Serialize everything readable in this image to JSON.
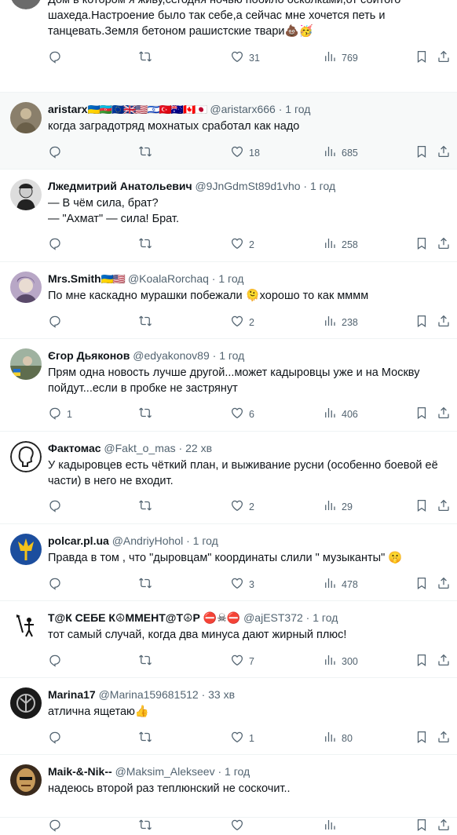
{
  "colors": {
    "text": "#0f1419",
    "muted": "#536471",
    "divider": "#eff3f4",
    "highlight": "#f7f9f9"
  },
  "tweets": [
    {
      "name": "",
      "handle": "",
      "time": "",
      "body": "Дом в котором я живу,сегодня ночью побило осколками,от сбитого шахеда.Настроение было так себе,а сейчас мне хочется петь и танцевать.Земля бетоном рашистские твари💩🥳",
      "replies": "",
      "retweets": "",
      "likes": "31",
      "views": "769"
    },
    {
      "name": "aristarx",
      "flags": "🇺🇦🇦🇿🇪🇺🇬🇧🇺🇸🇮🇱🇹🇷🇦🇺🇨🇦🇯🇵",
      "handle": "@aristarx666",
      "time": "1 год",
      "body": "когда заградотряд мохнатых сработал как надо",
      "replies": "",
      "retweets": "",
      "likes": "18",
      "views": "685"
    },
    {
      "name": "Лжедмитрий Анатольевич",
      "handle": "@9JnGdmSt89d1vho",
      "time": "1 год",
      "body": "— В чём сила, брат?\n— \"Ахмат\" — сила! Брат.",
      "replies": "",
      "retweets": "",
      "likes": "2",
      "views": "258"
    },
    {
      "name": "Mrs.Smith",
      "flags": "🇺🇦🇺🇸",
      "handle": "@KoalaRorchaq",
      "time": "1 год",
      "body": "По мне каскадно мурашки побежали 🫠хорошо то как мммм",
      "replies": "",
      "retweets": "",
      "likes": "2",
      "views": "238"
    },
    {
      "name": "Єгор Дьяконов",
      "handle": "@edyakonov89",
      "time": "1 год",
      "body": "Прям одна новость лучше другой...может кадыровцы уже и на Москву пойдут...если в пробке не застрянут",
      "replies": "1",
      "retweets": "",
      "likes": "6",
      "views": "406"
    },
    {
      "name": "Фактомас",
      "handle": "@Fakt_o_mas",
      "time": "22 хв",
      "body": "У кадыровцев есть чёткий план, и выживание русни (особенно боевой её части) в него не входит.",
      "replies": "",
      "retweets": "",
      "likes": "2",
      "views": "29"
    },
    {
      "name": "polcar.pl.ua",
      "handle": "@AndriyHohol",
      "time": "1 год",
      "body": "Правда в том , что \"дыровцам\"  координаты слили \" музыканты\" 🤫",
      "replies": "",
      "retweets": "",
      "likes": "3",
      "views": "478"
    },
    {
      "name": "Т@К СЕБЕ К☮ММЕНТ@Т☮Р ⛔☠⛔",
      "handle": "@ajEST372",
      "time": "1 год",
      "body": "тот самый случай, когда два минуса дают жирный плюс!",
      "replies": "",
      "retweets": "",
      "likes": "7",
      "views": "300"
    },
    {
      "name": "Marina17",
      "handle": "@Marina159681512",
      "time": "33 хв",
      "body": "атлична ящетаю👍",
      "replies": "",
      "retweets": "",
      "likes": "1",
      "views": "80"
    },
    {
      "name": "Maik-&-Nik--",
      "handle": "@Maksim_Alekseev",
      "time": "1 год",
      "body": "надеюсь второй раз теплюнский не соскочит..",
      "replies": "",
      "retweets": "",
      "likes": "",
      "views": ""
    }
  ]
}
